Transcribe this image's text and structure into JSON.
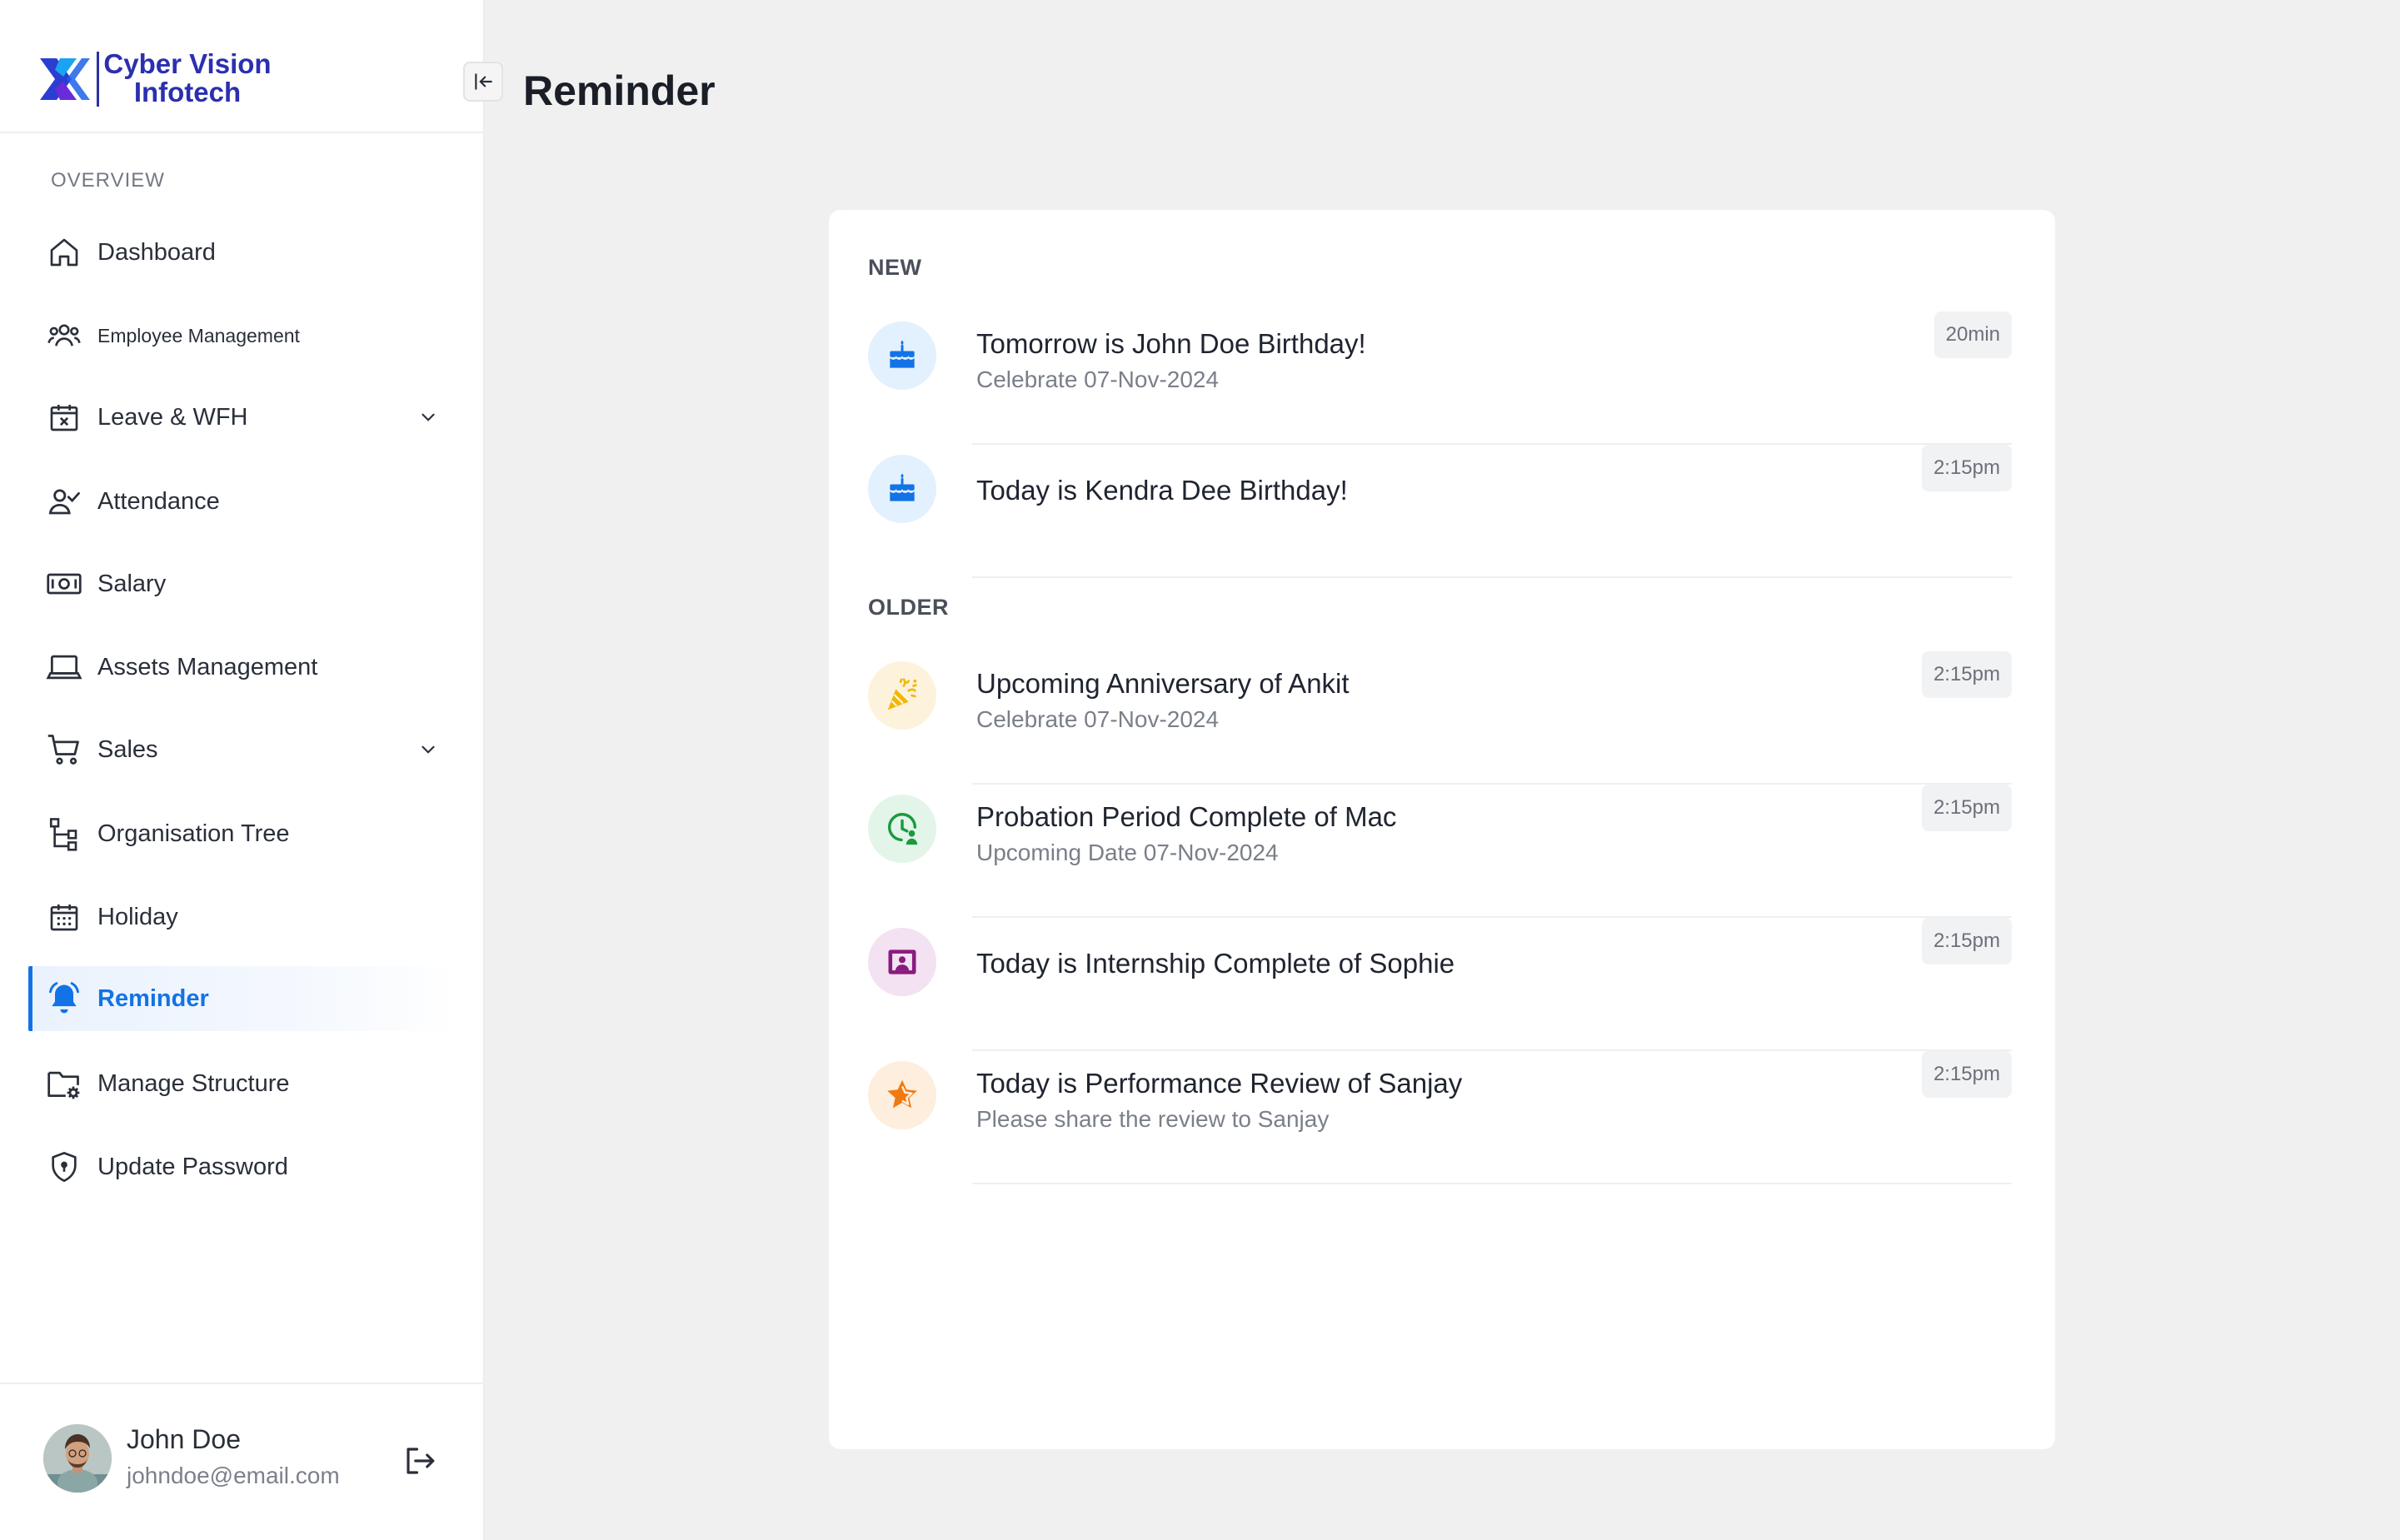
{
  "brand": {
    "line1": "Cyber Vision",
    "line2": "Infotech"
  },
  "sidebar": {
    "section_label": "OVERVIEW",
    "items": [
      {
        "label": "Dashboard",
        "icon": "home-icon"
      },
      {
        "label": "Employee Management",
        "icon": "users-icon"
      },
      {
        "label": "Leave & WFH",
        "icon": "calendar-x-icon",
        "expandable": true
      },
      {
        "label": "Attendance",
        "icon": "user-check-icon"
      },
      {
        "label": "Salary",
        "icon": "banknote-icon"
      },
      {
        "label": "Assets Management",
        "icon": "laptop-icon"
      },
      {
        "label": "Sales",
        "icon": "cart-icon",
        "expandable": true
      },
      {
        "label": "Organisation Tree",
        "icon": "tree-icon"
      },
      {
        "label": "Holiday",
        "icon": "calendar-icon"
      },
      {
        "label": "Reminder",
        "icon": "bell-icon",
        "active": true
      },
      {
        "label": "Manage Structure",
        "icon": "folder-gear-icon"
      },
      {
        "label": "Update Password",
        "icon": "shield-icon"
      }
    ]
  },
  "user": {
    "name": "John Doe",
    "email": "johndoe@email.com"
  },
  "page": {
    "title": "Reminder"
  },
  "reminders": {
    "new_label": "NEW",
    "older_label": "OLDER",
    "new": [
      {
        "title": "Tomorrow is John Doe Birthday!",
        "subtitle": "Celebrate 07-Nov-2024",
        "time": "20min",
        "icon": "cake-icon"
      },
      {
        "title": "Today is Kendra Dee Birthday!",
        "subtitle": "",
        "time": "2:15pm",
        "icon": "cake-icon"
      }
    ],
    "older": [
      {
        "title": "Upcoming Anniversary of Ankit",
        "subtitle": "Celebrate 07-Nov-2024",
        "time": "2:15pm",
        "icon": "party-popper-icon"
      },
      {
        "title": "Probation Period Complete of Mac",
        "subtitle": "Upcoming Date 07-Nov-2024",
        "time": "2:15pm",
        "icon": "clock-user-icon"
      },
      {
        "title": "Today is Internship Complete of Sophie",
        "subtitle": "",
        "time": "2:15pm",
        "icon": "certificate-icon"
      },
      {
        "title": "Today is Performance Review of Sanjay",
        "subtitle": "Please share the review to Sanjay",
        "time": "2:15pm",
        "icon": "star-icon"
      }
    ]
  },
  "colors": {
    "accent": "#1273e6",
    "brand": "#2b30b0",
    "cake_bg": "#e3f0fd",
    "party_bg": "#fdf3dc",
    "probation_bg": "#e3f5e8",
    "internship_bg": "#f3e2f1",
    "review_bg": "#fdeedd"
  }
}
